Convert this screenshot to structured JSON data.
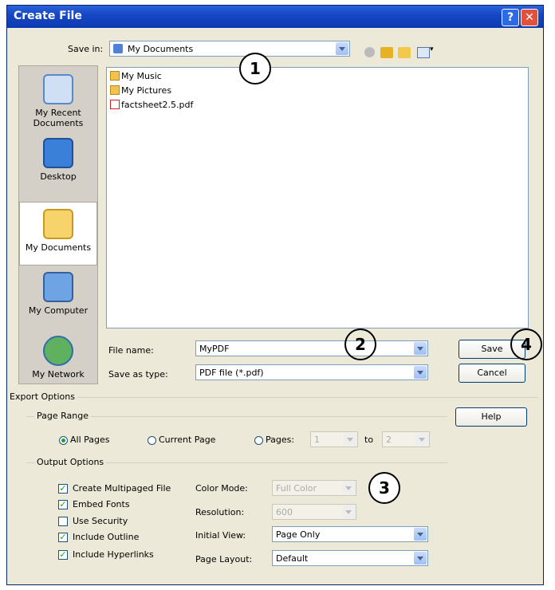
{
  "window": {
    "title": "Create File",
    "help_glyph": "?",
    "close_glyph": "✕"
  },
  "toolbar": {
    "save_in_label": "Save in:",
    "save_in_value": "My Documents",
    "view_menu_glyph": "▾"
  },
  "places": [
    {
      "label": "My Recent Documents",
      "icon": "recent-documents-icon"
    },
    {
      "label": "Desktop",
      "icon": "desktop-icon"
    },
    {
      "label": "My Documents",
      "icon": "my-documents-icon"
    },
    {
      "label": "My Computer",
      "icon": "my-computer-icon"
    },
    {
      "label": "My Network",
      "icon": "my-network-icon"
    }
  ],
  "files": [
    {
      "name": "My Music",
      "icon": "folder-icon"
    },
    {
      "name": "My Pictures",
      "icon": "folder-icon"
    },
    {
      "name": "factsheet2.5.pdf",
      "icon": "pdf-icon"
    }
  ],
  "file_name": {
    "label": "File name:",
    "value": "MyPDF"
  },
  "save_as_type": {
    "label": "Save as type:",
    "value": "PDF file (*.pdf)"
  },
  "buttons": {
    "save": "Save",
    "cancel": "Cancel",
    "help": "Help"
  },
  "export": {
    "title": "Export Options",
    "page_range": {
      "title": "Page Range",
      "all_pages": "All Pages",
      "current_page": "Current Page",
      "pages": "Pages:",
      "from": "1",
      "to_label": "to",
      "to": "2"
    },
    "output": {
      "title": "Output Options",
      "create_multipaged": "Create Multipaged File",
      "embed_fonts": "Embed Fonts",
      "use_security": "Use Security",
      "include_outline": "Include Outline",
      "include_hyperlinks": "Include Hyperlinks",
      "color_mode_label": "Color Mode:",
      "color_mode_value": "Full Color",
      "resolution_label": "Resolution:",
      "resolution_value": "600",
      "initial_view_label": "Initial View:",
      "initial_view_value": "Page Only",
      "page_layout_label": "Page Layout:",
      "page_layout_value": "Default",
      "check_glyph": "✓"
    }
  },
  "callouts": [
    "1",
    "2",
    "3",
    "4"
  ]
}
